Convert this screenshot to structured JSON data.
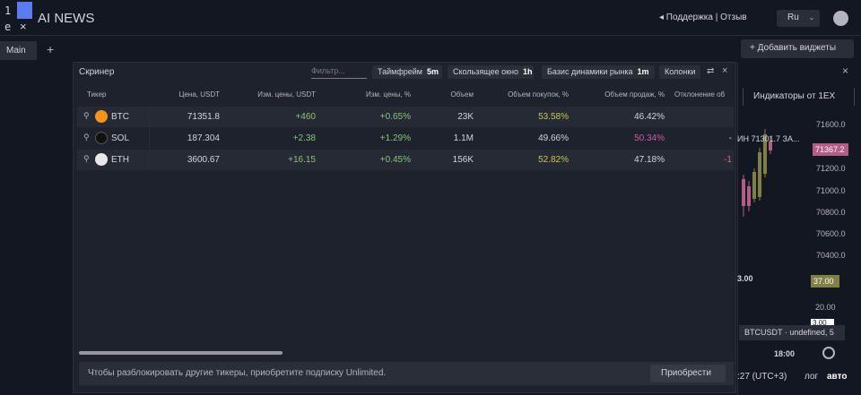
{
  "logo": {
    "digit": "1",
    "letter": "e",
    "close_glyph": "×"
  },
  "app": {
    "title": "AI NEWS"
  },
  "header": {
    "support": "◂ Поддержка | Отзыв",
    "lang": "Ru",
    "lang_caret": "⌄"
  },
  "tabs": {
    "main_label": "Main",
    "add_glyph": "+"
  },
  "toolbar": {
    "add_widget": "+ Добавить виджеты"
  },
  "right_panel": {
    "close_glyph": "×",
    "tab_label": "Индикаторы от 1EX",
    "price_ticks": [
      "71600.0",
      "71200.0",
      "71000.0",
      "70800.0",
      "70600.0",
      "70400.0"
    ],
    "price_tag": "71367.2",
    "ohlc_label": "ИН 71301.7 ЗА...",
    "indicator_value": "3.00",
    "indicator_tag": "37.00",
    "tick_20": "20.00",
    "tick_3": "3.00",
    "tooltip": "BTCUSDT · undefined, 5",
    "time": "18:00",
    "utc": ":27 (UTC+3)",
    "log": "лог",
    "auto": "авто"
  },
  "screener": {
    "title": "Скринер",
    "filter_placeholder": "Фильтр...",
    "chips": {
      "timeframe": {
        "label": "Таймфрейм",
        "value": "5m"
      },
      "window": {
        "label": "Скользящее окно",
        "value": "1h"
      },
      "base": {
        "label": "Базис динамики рынка",
        "value": "1m"
      },
      "columns": {
        "label": "Колонки"
      }
    },
    "swap_glyph": "⇄",
    "close_glyph": "×",
    "columns": [
      "Тикер",
      "Цена, USDT",
      "Изм. цены, USDT",
      "Изм. цены, %",
      "Объем",
      "Объем покупок, %",
      "Объем продаж, %",
      "Отклонение об"
    ],
    "rows": [
      {
        "sym": "BTC",
        "price": "71351.8",
        "chg": "+460",
        "chg_pct": "+0.65%",
        "vol": "23K",
        "buy": "53.58%",
        "sell": "46.42%",
        "dev": "",
        "coin_color": "#f7931a"
      },
      {
        "sym": "SOL",
        "price": "187.304",
        "chg": "+2.38",
        "chg_pct": "+1.29%",
        "vol": "1.1M",
        "buy": "49.66%",
        "sell": "50.34%",
        "dev": "-",
        "coin_color": "#111111"
      },
      {
        "sym": "ETH",
        "price": "3600.67",
        "chg": "+16.15",
        "chg_pct": "+0.45%",
        "vol": "156K",
        "buy": "52.82%",
        "sell": "47.18%",
        "dev": "-1",
        "coin_color": "#e8e8e8"
      }
    ],
    "pin_glyph": "⚲",
    "footer": {
      "text": "Чтобы разблокировать другие тикеры, приобретите подписку Unlimited.",
      "button": "Приобрести"
    }
  },
  "colors": {
    "background": "#131722",
    "panel": "#1e222d",
    "accent": "#5b7cf0",
    "positive": "#89c27a",
    "buy": "#c8c64b",
    "sell": "#d05aa8"
  }
}
